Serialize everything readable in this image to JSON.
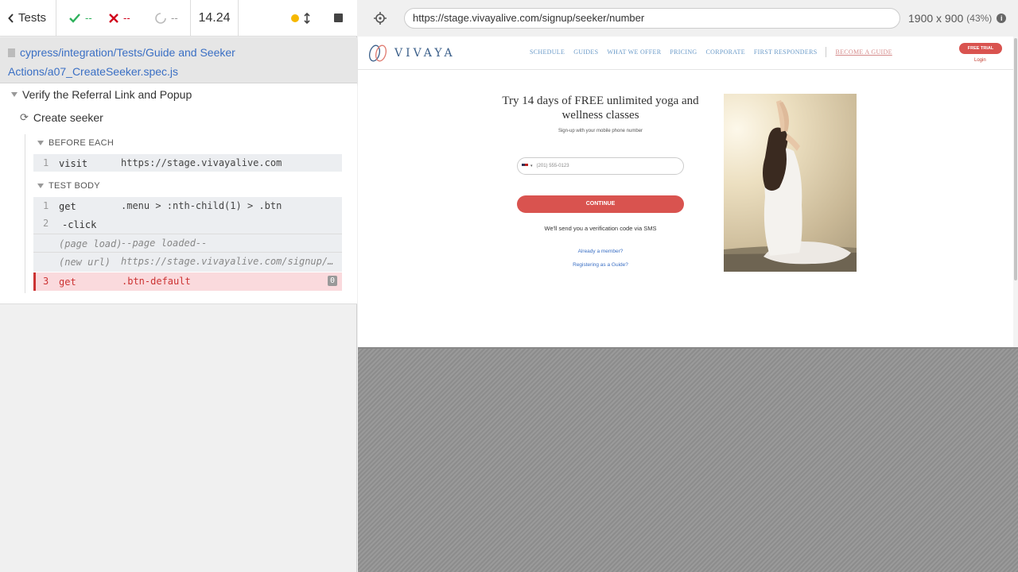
{
  "reporter": {
    "tests_label": "Tests",
    "passed": "--",
    "failed": "--",
    "pending": "--",
    "duration": "14.24",
    "spec_path": "cypress/integration/Tests/Guide and Seeker Actions/a07_CreateSeeker.spec.js",
    "suite_title": "Verify the Referral Link and Popup",
    "test_title": "Create seeker",
    "before_each_label": "BEFORE EACH",
    "test_body_label": "TEST BODY",
    "commands": [
      {
        "num": "1",
        "name": "visit",
        "msg": "https://stage.vivayalive.com"
      },
      {
        "num": "1",
        "name": "get",
        "msg": ".menu > :nth-child(1) > .btn"
      },
      {
        "num": "2",
        "name": "-click",
        "msg": ""
      },
      {
        "num": "",
        "name": "(page load)",
        "msg": "--page loaded--"
      },
      {
        "num": "",
        "name": "(new url)",
        "msg": "https://stage.vivayalive.com/signup/seeker/number"
      },
      {
        "num": "3",
        "name": "get",
        "msg": ".btn-default",
        "count": "0"
      }
    ]
  },
  "aut": {
    "url": "https://stage.vivayalive.com/signup/seeker/number",
    "viewport": "1900 x 900",
    "scale": "(43%)"
  },
  "site": {
    "logo_text": "VIVAYA",
    "nav": [
      "SCHEDULE",
      "GUIDES",
      "WHAT WE OFFER",
      "PRICING",
      "CORPORATE",
      "FIRST RESPONDERS"
    ],
    "nav_guide": "BECOME A GUIDE",
    "free_trial": "FREE TRIAL",
    "login": "Login",
    "hero_title": "Try 14 days of FREE unlimited yoga and wellness classes",
    "hero_sub": "Sign-up with your mobile phone number",
    "phone_placeholder": "(201) 555-0123",
    "continue": "CONTINUE",
    "sms_note": "We'll send you a verification code via SMS",
    "member_link": "Already a member?",
    "guide_link": "Registering as a Guide?"
  },
  "colors": {
    "pass": "#2eb15c",
    "fail": "#d0021b",
    "running": "#f6b800",
    "brand_red": "#d9534f",
    "link_blue": "#3a6fc4"
  },
  "icons": {
    "back": "chevron-left-icon",
    "pass": "check-icon",
    "fail": "x-icon",
    "pending": "circle-icon",
    "selector": "crosshair-icon",
    "info": "info-icon"
  }
}
